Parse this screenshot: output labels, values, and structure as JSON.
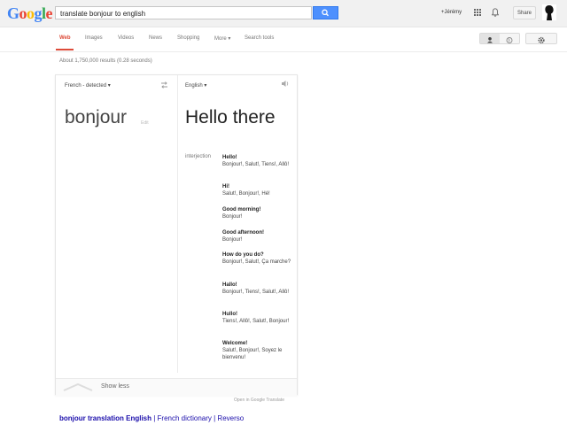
{
  "header": {
    "logo": "Google",
    "search_query": "translate bonjour to english",
    "user_link": "+Jérémy",
    "share_label": "Share"
  },
  "tabs": [
    {
      "label": "Web",
      "active": true
    },
    {
      "label": "Images"
    },
    {
      "label": "Videos"
    },
    {
      "label": "News"
    },
    {
      "label": "Shopping"
    },
    {
      "label": "More ▾"
    },
    {
      "label": "Search tools"
    }
  ],
  "result_stats": "About 1,750,000 results (0.28 seconds)",
  "translate": {
    "source_lang": "French - detected ▾",
    "target_lang": "English ▾",
    "source_word": "bonjour",
    "edit_label": "Edit",
    "target_word": "Hello there",
    "part_of_speech": "interjection",
    "entries": [
      {
        "term": "Hello!",
        "synonyms": "Bonjour!, Salut!, Tiens!, Allô!"
      },
      {
        "term": "Hi!",
        "synonyms": "Salut!, Bonjour!, Hé!"
      },
      {
        "term": "Good morning!",
        "synonyms": "Bonjour!"
      },
      {
        "term": "Good afternoon!",
        "synonyms": "Bonjour!"
      },
      {
        "term": "How do you do?",
        "synonyms": "Bonjour!, Salut!, Ça marche?"
      },
      {
        "term": "Hallo!",
        "synonyms": "Bonjour!, Tiens!, Salut!, Allô!"
      },
      {
        "term": "Hullo!",
        "synonyms": "Tiens!, Allô!, Salut!, Bonjour!"
      },
      {
        "term": "Welcome!",
        "synonyms": "Salut!, Bonjour!, Soyez le bienvenu!"
      }
    ],
    "show_less": "Show less",
    "open_link": "Open in Google Translate"
  },
  "result": {
    "title_bold": "bonjour translation English",
    "sep1": " | ",
    "part2": "French dictionary",
    "sep2": " | ",
    "part3": "Reverso"
  },
  "colors": {
    "accent": "#dd4b39",
    "search_button": "#4d90fe",
    "link": "#1a0dab"
  }
}
